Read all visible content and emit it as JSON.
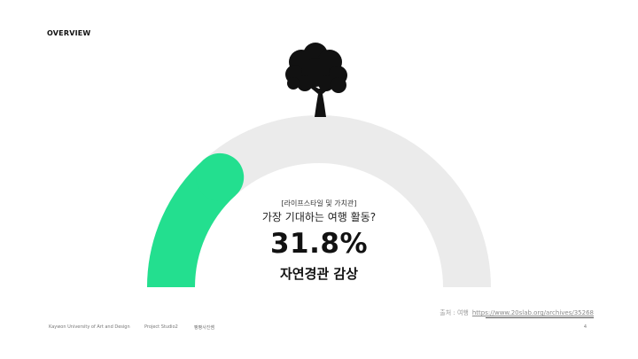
{
  "header": {
    "section_title": "OVERVIEW"
  },
  "gauge": {
    "value_percent": 31.8,
    "fill_color": "#23df8f",
    "track_color": "#ebebeb",
    "top_icon": "tree-icon"
  },
  "stat": {
    "category": "[라이프스타일 및 가치관]",
    "question": "가장 기대하는 여행 활동?",
    "percentage": "31.8%",
    "answer": "자연경관 감상"
  },
  "source": {
    "label": "출처 : 여행",
    "url": "https://www.20slab.org/archives/35268"
  },
  "footer": {
    "university": "Kaywon University of Art and Design",
    "project": "Project Studio2",
    "team": "빵빵사진쌤",
    "page_number": "4"
  }
}
